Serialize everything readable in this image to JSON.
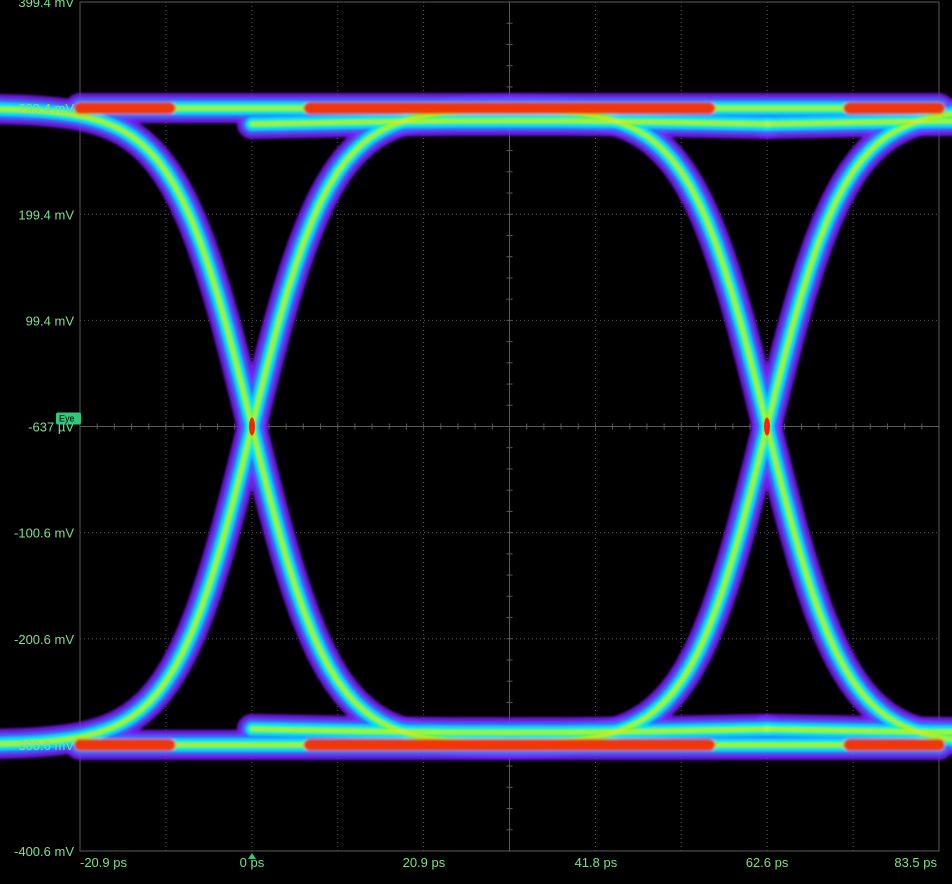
{
  "chart_data": {
    "type": "scatter",
    "subtype": "eye-diagram",
    "title": "",
    "xlabel": "",
    "ylabel": "",
    "x_ticks": [
      "-20.9 ps",
      "0 ps",
      "20.9 ps",
      "41.8 ps",
      "62.6 ps",
      "83.5 ps"
    ],
    "y_ticks": [
      "399.4 mV",
      "299.4 mV",
      "199.4 mV",
      "99.4 mV",
      "-637 µV",
      "-100.6 mV",
      "-200.6 mV",
      "-300.6 mV",
      "-400.6 mV"
    ],
    "xlim": [
      -20.9,
      83.5
    ],
    "ylim": [
      -400.6,
      399.4
    ],
    "x_unit": "ps",
    "y_unit": "mV",
    "unit_interval_ps": 62.6,
    "crossing_points": [
      {
        "x": 0,
        "y": -0.637
      },
      {
        "x": 62.6,
        "y": -0.637
      }
    ],
    "levels": {
      "high": 299.4,
      "low": -300.6
    },
    "grid": true,
    "reference_marker": {
      "label": "Eye",
      "y": -0.637
    },
    "colors": {
      "background": "#000000",
      "grid": "#5a5a5a",
      "label": "#7fe08a",
      "density": [
        "#7a1cff",
        "#2a6bff",
        "#00e5ff",
        "#26ff5a",
        "#ffe400",
        "#ff2200"
      ]
    }
  }
}
